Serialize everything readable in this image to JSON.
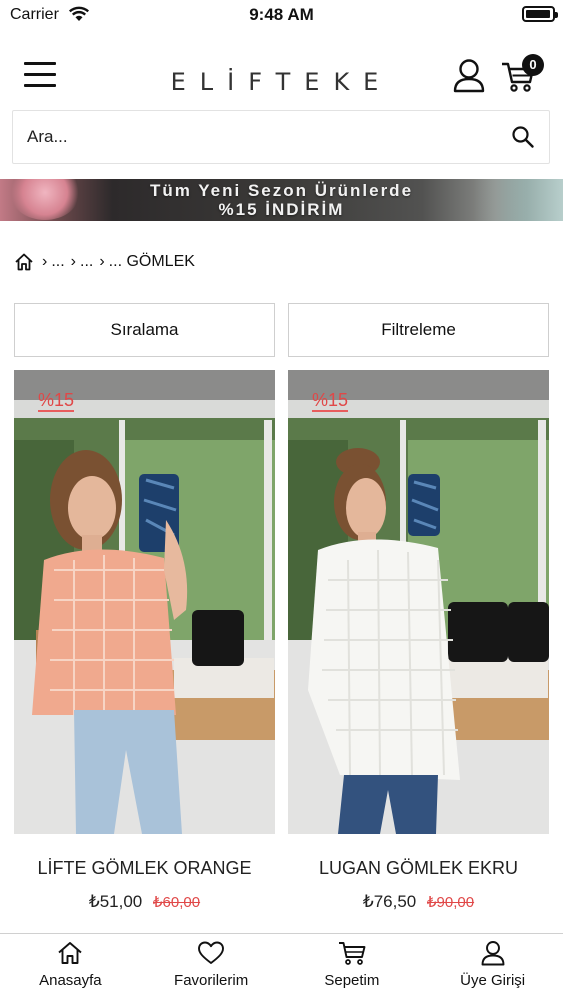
{
  "status_bar": {
    "carrier": "Carrier",
    "time": "9:48 AM",
    "battery_level": 0.95
  },
  "header": {
    "logo": "ELİFTEKE",
    "cart_count": "0"
  },
  "search": {
    "placeholder": "Ara..."
  },
  "banner": {
    "line1": "Tüm Yeni Sezon Ürünlerde",
    "line2": "%15 İNDİRİM"
  },
  "breadcrumb": {
    "items": [
      "...",
      "...",
      "... GÖMLEK"
    ]
  },
  "controls": {
    "sort_label": "Sıralama",
    "filter_label": "Filtreleme"
  },
  "products": [
    {
      "name": "LİFTE GÖMLEK ORANGE",
      "price": "₺51,00",
      "old_price": "₺60,00",
      "discount": "%15"
    },
    {
      "name": "LUGAN GÖMLEK EKRU",
      "price": "₺76,50",
      "old_price": "₺90,00",
      "discount": "%15"
    }
  ],
  "tabbar": {
    "items": [
      "Anasayfa",
      "Favorilerim",
      "Sepetim",
      "Üye Girişi"
    ]
  },
  "icons": [
    "wifi-icon",
    "battery-icon",
    "menu-icon",
    "user-icon",
    "cart-icon",
    "search-icon",
    "home-icon",
    "heart-icon"
  ]
}
